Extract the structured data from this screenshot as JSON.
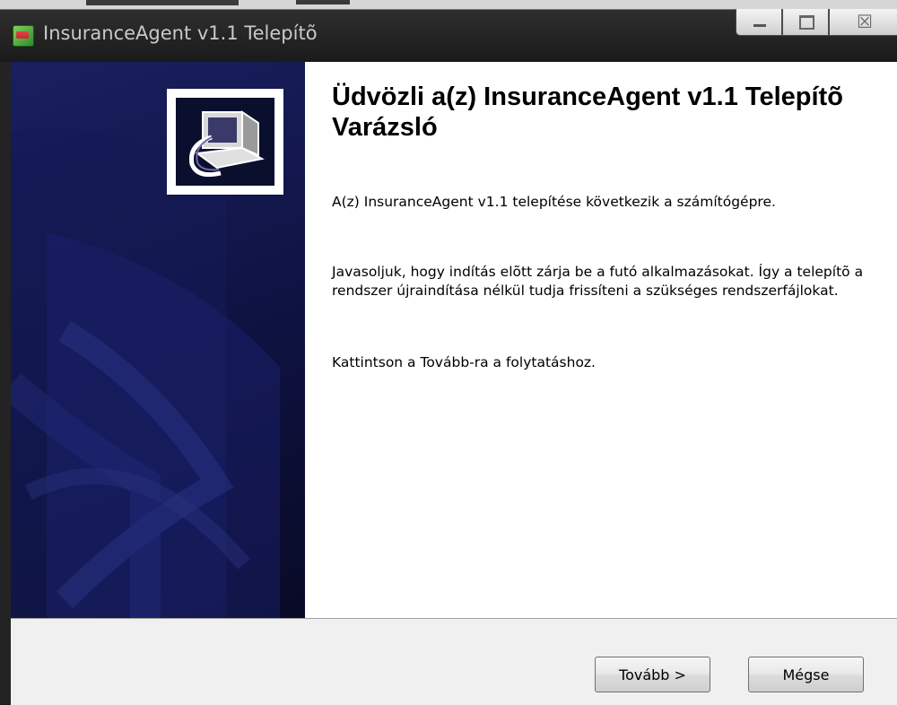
{
  "window": {
    "title": "InsuranceAgent v1.1 Telepítõ",
    "controls": {
      "minimize": "minimize-icon",
      "maximize": "maximize-icon",
      "close": "close-icon",
      "close_glyph": "☒"
    }
  },
  "page": {
    "heading": "Üdvözli a(z) InsuranceAgent v1.1 Telepítõ Varázsló",
    "paragraph1": "A(z) InsuranceAgent v1.1 telepítése következik a számítógépre.",
    "paragraph2": "Javasoljuk, hogy indítás elõtt zárja be a futó alkalmazásokat. Így a telepítõ a rendszer újraindítása nélkül tudja frissíteni a szükséges rendszerfájlokat.",
    "paragraph3": "Kattintson a Tovább-ra a folytatáshoz."
  },
  "buttons": {
    "next": "Tovább >",
    "cancel": "Mégse"
  },
  "colors": {
    "sidebar": "#0e1240",
    "dialog_bg": "#ffffff",
    "button_bar": "#f0f0f0"
  }
}
